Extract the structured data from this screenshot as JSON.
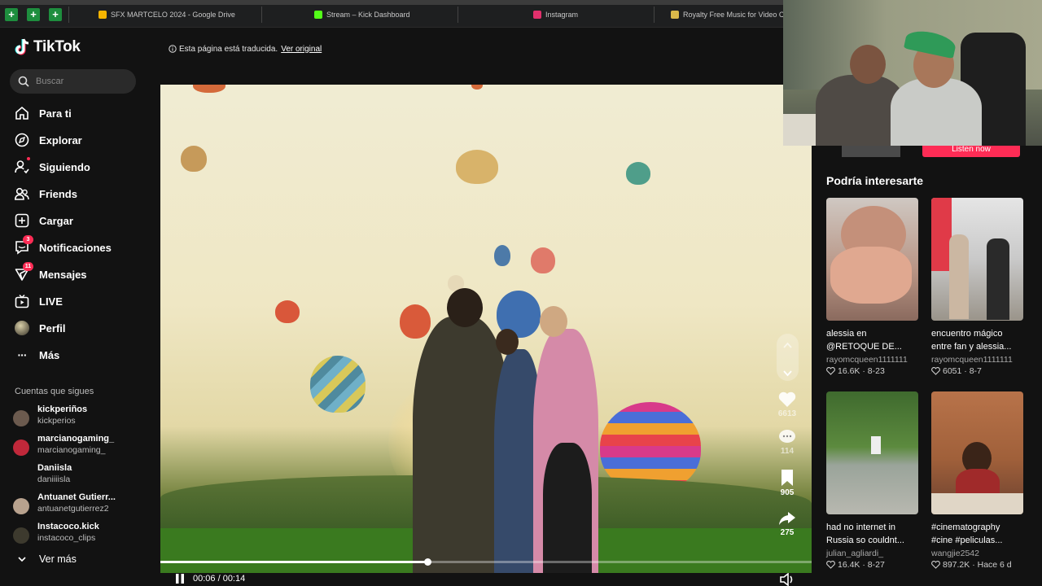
{
  "browser": {
    "tabs": [
      {
        "title": "SFX MARTCELO 2024 - Google Drive",
        "color": "#f4b400"
      },
      {
        "title": "Stream – Kick Dashboard",
        "color": "#53fc18"
      },
      {
        "title": "Instagram",
        "color": "#e1306c"
      },
      {
        "title": "Royalty Free Music for Video Cr",
        "color": "#d9b84a"
      }
    ]
  },
  "sidebar": {
    "brand": "TikTok",
    "search_placeholder": "Buscar",
    "nav": [
      {
        "label": "Para ti",
        "icon": "home-icon"
      },
      {
        "label": "Explorar",
        "icon": "compass-icon"
      },
      {
        "label": "Siguiendo",
        "icon": "following-icon"
      },
      {
        "label": "Friends",
        "icon": "friends-icon"
      },
      {
        "label": "Cargar",
        "icon": "upload-icon"
      },
      {
        "label": "Notificaciones",
        "icon": "inbox-icon",
        "badge": "3"
      },
      {
        "label": "Mensajes",
        "icon": "messages-icon",
        "badge": "11"
      },
      {
        "label": "LIVE",
        "icon": "live-icon"
      },
      {
        "label": "Perfil",
        "icon": "profile-icon"
      },
      {
        "label": "Más",
        "icon": "more-icon"
      }
    ],
    "following_title": "Cuentas que sigues",
    "accounts": [
      {
        "name": "kickperiños",
        "handle": "kickperios",
        "color": "#6b5a4e"
      },
      {
        "name": "marcianogaming_",
        "handle": "marcianogaming_",
        "color": "#c0283a"
      },
      {
        "name": "Daniisla",
        "handle": "daniiiisla",
        "color": ""
      },
      {
        "name": "Antuanet Gutierr...",
        "handle": "antuanetgutierrez2",
        "color": "#b8a28e"
      },
      {
        "name": "Instacoco.kick",
        "handle": "instacoco_clips",
        "color": "#3d3a2e"
      }
    ],
    "see_more": "Ver más"
  },
  "translation": {
    "text": "Esta página está traducida.",
    "link": "Ver original"
  },
  "video": {
    "likes": "6613",
    "comments": "114",
    "saves": "905",
    "shares": "275",
    "time": "00:06 / 00:14",
    "progress": 0.41
  },
  "right": {
    "listen_now": "Listen now",
    "suggest_title": "Podría interesarte",
    "cards": [
      {
        "title": "alessia en @RETOQUE DE...",
        "author": "rayomcqueen1111111",
        "stats": "16.6K · 8-23"
      },
      {
        "title": "encuentro mágico entre fan y alessia...",
        "author": "rayomcqueen1111111",
        "stats": "6051 · 8-7"
      },
      {
        "title": "had no internet in Russia so couldnt...",
        "author": "julian_agliardi_",
        "stats": "16.4K · 8-27"
      },
      {
        "title": "#cinematography #cine #peliculas...",
        "author": "wangjie2542",
        "stats": "897.2K · Hace 6 d"
      }
    ]
  }
}
